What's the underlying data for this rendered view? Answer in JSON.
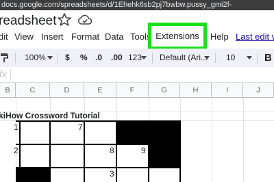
{
  "browser": {
    "url": "docs.google.com/spreadsheets/d/1Ehehk6sb2pj7bwbw.pussy_gmi2f-"
  },
  "document": {
    "title": "readsheet"
  },
  "menu": {
    "items": [
      "dit",
      "View",
      "Insert",
      "Format",
      "Data",
      "Tools",
      "Extensions",
      "Help"
    ],
    "last_edit": "Last edit w"
  },
  "toolbar": {
    "zoom": "100%",
    "currency": "$",
    "percent": "%",
    "decrease_decimals": ".0",
    "increase_decimals": ".00",
    "number_format": "123",
    "font": "Default (Ari...",
    "font_size": "10",
    "bold": "B"
  },
  "formula_bar": {
    "fx": "fx"
  },
  "sheet": {
    "columns": [
      "B",
      "C",
      "D",
      "E",
      "F",
      "G",
      "H",
      "I",
      "J"
    ],
    "title_cell": "kiHow Crossword Tutorial",
    "clue_numbers": [
      "1",
      "7",
      "2",
      "8",
      "9",
      "3"
    ]
  },
  "colors": {
    "highlight": "#19e019",
    "toolbar_bg": "#eef2f8",
    "link": "#1a0dab"
  },
  "icons": [
    "star-icon",
    "cloud-check-icon",
    "paint-format-icon",
    "chevron-down-icon",
    "bold-icon"
  ]
}
